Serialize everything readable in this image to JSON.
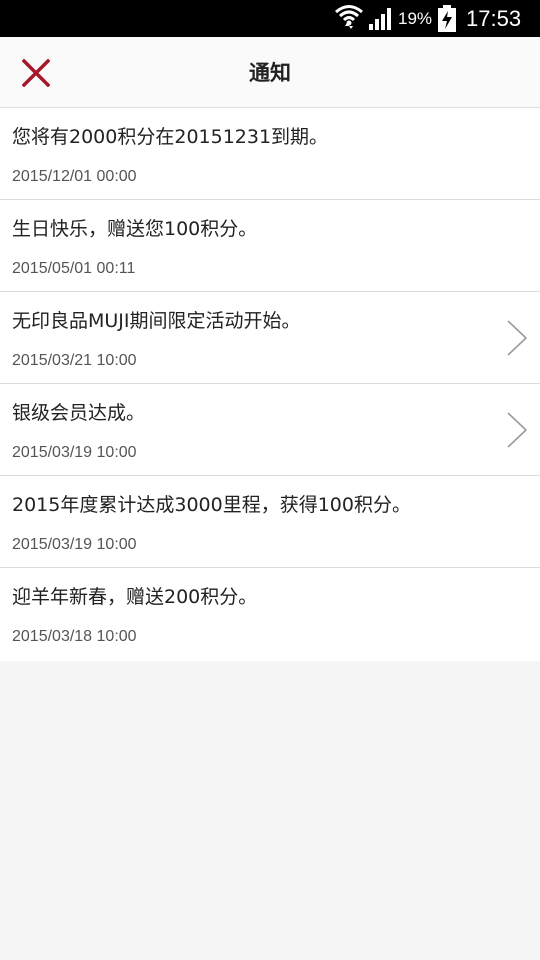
{
  "status_bar": {
    "battery_percent": "19%",
    "time": "17:53"
  },
  "header": {
    "title": "通知",
    "close_icon": "close-x-icon",
    "accent_color": "#a5182a"
  },
  "notifications": [
    {
      "message": "您将有2000积分在20151231到期。",
      "time": "2015/12/01 00:00",
      "has_chevron": false
    },
    {
      "message": "生日快乐，赠送您100积分。",
      "time": "2015/05/01 00:11",
      "has_chevron": false
    },
    {
      "message": "无印良品MUJI期间限定活动开始。",
      "time": "2015/03/21 10:00",
      "has_chevron": true
    },
    {
      "message": "银级会员达成。",
      "time": "2015/03/19 10:00",
      "has_chevron": true
    },
    {
      "message": "2015年度累计达成3000里程，获得100积分。",
      "time": "2015/03/19 10:00",
      "has_chevron": false
    },
    {
      "message": "迎羊年新春，赠送200积分。",
      "time": "2015/03/18 10:00",
      "has_chevron": false
    }
  ]
}
